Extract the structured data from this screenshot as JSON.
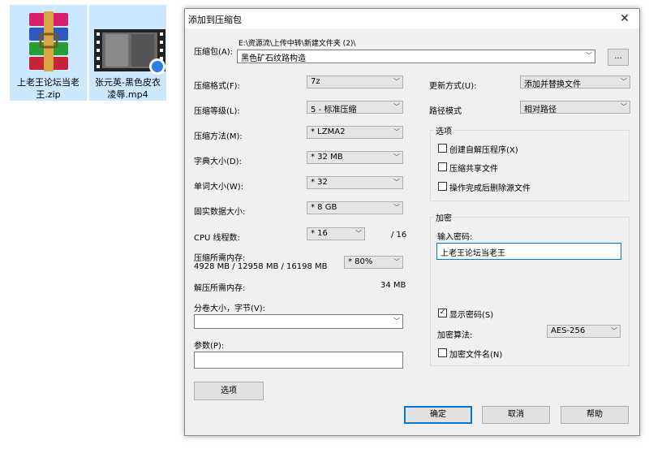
{
  "desktop": {
    "files": [
      {
        "name_line1": "上老王论坛当老",
        "name_line2": "王.zip",
        "icon": "winrar-archive-icon"
      },
      {
        "name_line1": "张元英-黑色皮衣",
        "name_line2": "凌辱.mp4",
        "icon": "video-file-icon"
      }
    ]
  },
  "dialog": {
    "title": "添加到压缩包",
    "close_glyph": "✕",
    "archive": {
      "label": "压缩包(A):",
      "path": "E:\\资源流\\上传中转\\新建文件夹 (2)\\",
      "name": "黑色矿石纹路构造",
      "browse": "..."
    },
    "left": {
      "format": {
        "label": "压缩格式(F):",
        "value": "7z"
      },
      "level": {
        "label": "压缩等级(L):",
        "value": "5 - 标准压缩"
      },
      "method": {
        "label": "压缩方法(M):",
        "value": "* LZMA2"
      },
      "dict": {
        "label": "字典大小(D):",
        "value": "* 32 MB"
      },
      "word": {
        "label": "单词大小(W):",
        "value": "* 32"
      },
      "solid": {
        "label": "固实数据大小:",
        "value": "* 8 GB"
      },
      "cpu": {
        "label": "CPU 线程数:",
        "value": "* 16",
        "total": "/ 16"
      },
      "mem_compress": {
        "label": "压缩所需内存:",
        "detail": "4928 MB / 12958 MB / 16198 MB",
        "value": "* 80%"
      },
      "mem_decompress": {
        "label": "解压所需内存:",
        "value": "34 MB"
      },
      "split": {
        "label": "分卷大小，字节(V):",
        "value": ""
      },
      "params": {
        "label": "参数(P):",
        "value": ""
      },
      "options_button": "选项"
    },
    "right": {
      "update": {
        "label": "更新方式(U):",
        "value": "添加并替换文件"
      },
      "pathmode": {
        "label": "路径模式",
        "value": "相对路径"
      },
      "options": {
        "title": "选项",
        "sfx": {
          "label": "创建自解压程序(X)",
          "checked": false
        },
        "shared": {
          "label": "压缩共享文件",
          "checked": false
        },
        "delete": {
          "label": "操作完成后删除源文件",
          "checked": false
        }
      },
      "encrypt": {
        "title": "加密",
        "password_label": "输入密码:",
        "password": "上老王论坛当老王",
        "show_password": {
          "label": "显示密码(S)",
          "checked": true
        },
        "method_label": "加密算法:",
        "method": "AES-256",
        "encrypt_names": {
          "label": "加密文件名(N)",
          "checked": false
        }
      }
    },
    "buttons": {
      "ok": "确定",
      "cancel": "取消",
      "help": "帮助"
    }
  }
}
